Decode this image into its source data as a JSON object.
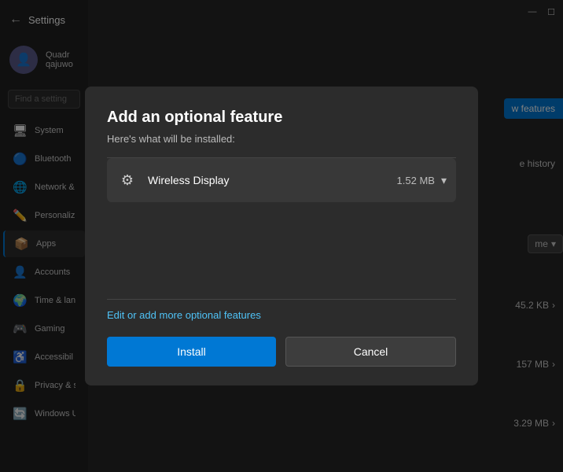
{
  "app": {
    "title": "Settings"
  },
  "titlebar": {
    "minimize_label": "—",
    "maximize_label": "☐"
  },
  "sidebar": {
    "back_icon": "←",
    "title": "Settings",
    "user": {
      "name": "Quadr",
      "sub": "qajuwo"
    },
    "search_placeholder": "Find a setting",
    "items": [
      {
        "id": "system",
        "label": "System",
        "icon": "🖥"
      },
      {
        "id": "bluetooth",
        "label": "Bluetooth",
        "icon": "🔵"
      },
      {
        "id": "network",
        "label": "Network &",
        "icon": "🌐"
      },
      {
        "id": "personalization",
        "label": "Personaliz",
        "icon": "✏️"
      },
      {
        "id": "apps",
        "label": "Apps",
        "icon": "📦",
        "active": true
      },
      {
        "id": "accounts",
        "label": "Accounts",
        "icon": "👤"
      },
      {
        "id": "time",
        "label": "Time & lan",
        "icon": "🌍"
      },
      {
        "id": "gaming",
        "label": "Gaming",
        "icon": "🎮"
      },
      {
        "id": "accessibility",
        "label": "Accessibil",
        "icon": "♿"
      },
      {
        "id": "privacy",
        "label": "Privacy & s",
        "icon": "🔒"
      },
      {
        "id": "windows",
        "label": "Windows U",
        "icon": "🔄"
      }
    ]
  },
  "right_panel": {
    "button_label": "w features",
    "history_label": "e history",
    "dropdown_label": "me",
    "size1": "45.2 KB",
    "size2": "157 MB",
    "size3": "3.29 MB"
  },
  "dialog": {
    "title": "Add an optional feature",
    "subtitle": "Here's what will be installed:",
    "feature": {
      "name": "Wireless Display",
      "icon": "⚙",
      "size": "1.52 MB"
    },
    "link_text": "Edit or add more optional features",
    "install_label": "Install",
    "cancel_label": "Cancel"
  }
}
